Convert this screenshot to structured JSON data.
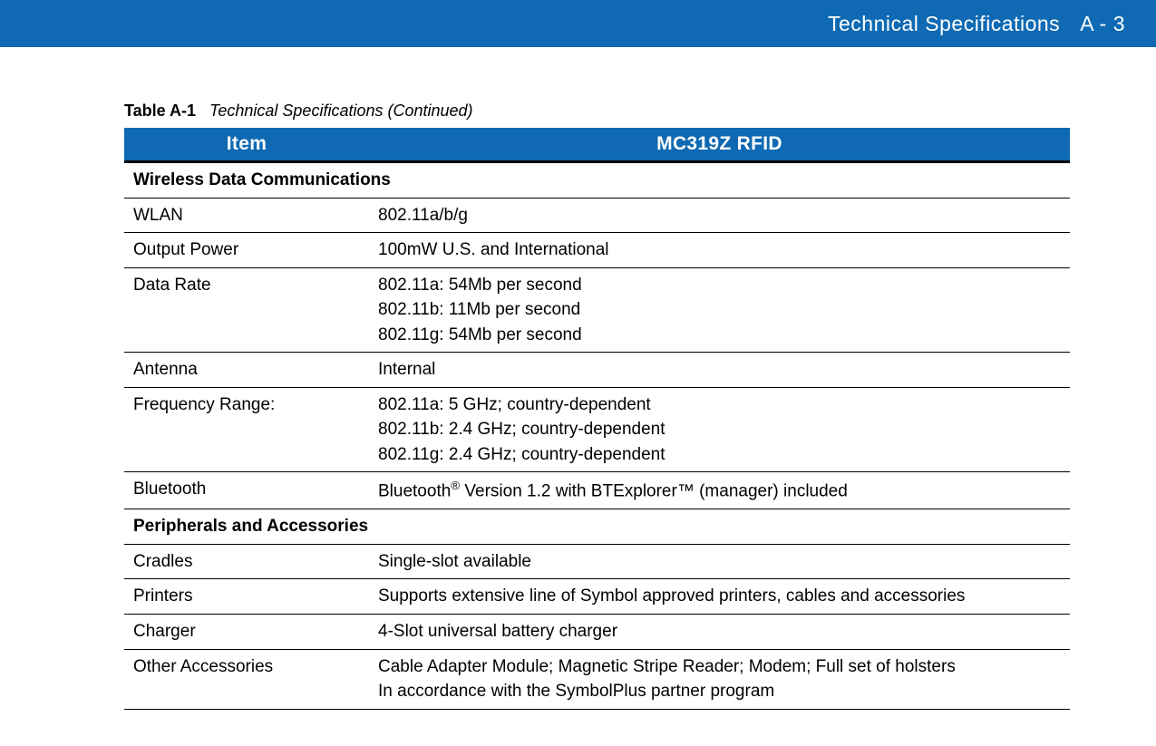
{
  "header": {
    "title": "Technical Specifications",
    "page": "A - 3"
  },
  "caption": {
    "label": "Table A-1",
    "title": "Technical Specifications (Continued)"
  },
  "columns": [
    "Item",
    "MC319Z RFID"
  ],
  "sections": [
    {
      "heading": "Wireless Data Communications",
      "rows": [
        {
          "item": "WLAN",
          "value": "802.11a/b/g"
        },
        {
          "item": "Output Power",
          "value": "100mW U.S. and International"
        },
        {
          "item": "Data Rate",
          "value": "802.11a: 54Mb per second\n802.11b: 11Mb per second\n802.11g: 54Mb per second"
        },
        {
          "item": "Antenna",
          "value": "Internal"
        },
        {
          "item": "Frequency Range:",
          "value": "802.11a: 5 GHz; country-dependent\n802.11b: 2.4 GHz; country-dependent\n802.11g: 2.4 GHz; country-dependent"
        },
        {
          "item": "Bluetooth",
          "value_html": "Bluetooth<sup>®</sup> Version 1.2 with BTExplorer™ (manager) included"
        }
      ]
    },
    {
      "heading": "Peripherals and Accessories",
      "rows": [
        {
          "item": "Cradles",
          "value": "Single-slot available"
        },
        {
          "item": "Printers",
          "value": "Supports extensive line of Symbol approved printers, cables and accessories"
        },
        {
          "item": "Charger",
          "value": "4-Slot universal battery charger"
        },
        {
          "item": "Other Accessories",
          "value": "Cable Adapter Module; Magnetic Stripe Reader; Modem; Full set of holsters\nIn accordance with the SymbolPlus partner program"
        }
      ]
    }
  ]
}
